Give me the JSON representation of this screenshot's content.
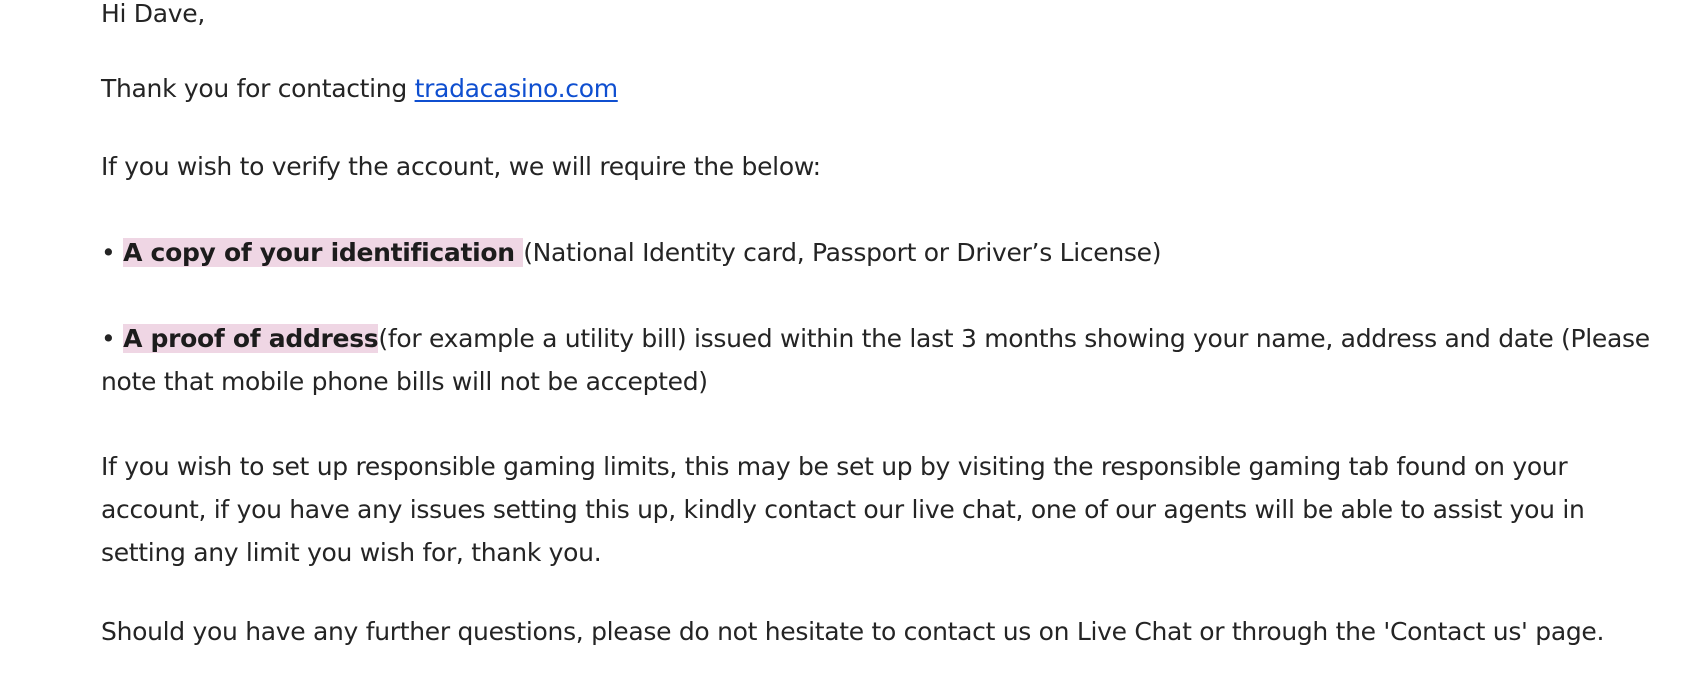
{
  "email": {
    "greeting": "Hi Dave,",
    "thanks_prefix": "Thank you for contacting ",
    "site_link": "tradacasino.com",
    "intro": "If you wish to verify the account, we will require the below:",
    "bullet_char": "•",
    "requirements": [
      {
        "title": "A copy of your identification ",
        "detail": "(National Identity card, Passport or Driver’s License)"
      },
      {
        "title": "A proof of address",
        "detail": "(for example a utility bill) issued within the last 3 months showing your name, address and date (Please note that mobile phone bills will not be accepted)"
      }
    ],
    "gaming_paragraph": "If you wish to set up responsible gaming limits, this may be set up by visiting the responsible gaming tab found on your account, if you have any issues setting this up, kindly contact our live chat, one of our agents will be able to assist you in setting any limit you wish for, thank you.",
    "further_questions": "Should you have any further questions, please do not hesitate to contact us on Live Chat or through the 'Contact us' page."
  },
  "colors": {
    "text": "#242424",
    "link": "#0f4fd0",
    "highlight": "#efd6e4"
  }
}
